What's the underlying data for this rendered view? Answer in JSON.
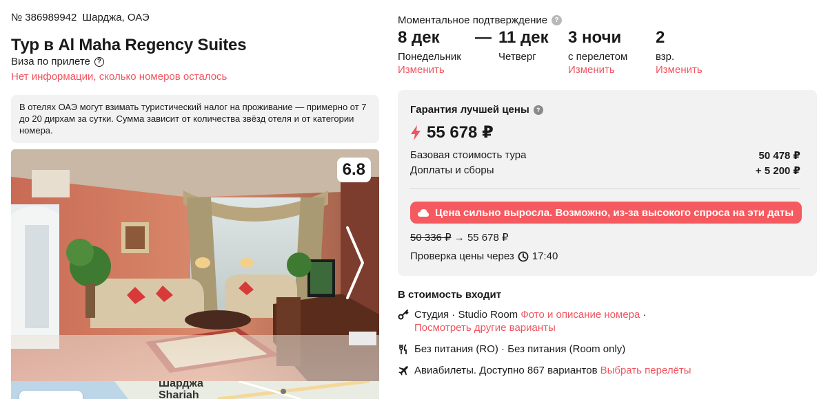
{
  "tour": {
    "id_text": "№ 386989942",
    "location": "Шарджа, ОАЭ",
    "title": "Тур в Al Maha Regency Suites",
    "visa": "Виза по прилете",
    "rooms_left": "Нет информации, сколько номеров осталось",
    "tax_note": "В отелях ОАЭ могут взимать туристический налог на проживание — примерно от 7 до 20 дирхам за сутки. Сумма зависит от количества звёзд отеля и от категории номера.",
    "rating": "6.8",
    "map_label_ru": "Шарджа",
    "map_label_en": "Shariah"
  },
  "booking": {
    "instant_confirm": "Моментальное подтверждение",
    "date_from": "8 дек",
    "date_from_day": "Понедельник",
    "dash": "—",
    "date_to": "11 дек",
    "date_to_day": "Четверг",
    "nights": "3 ночи",
    "nights_sub": "с перелетом",
    "guests": "2",
    "guests_sub": "взр.",
    "change_label": "Изменить"
  },
  "price": {
    "guarantee": "Гарантия лучшей цены",
    "total": "55 678 ₽",
    "base_label": "Базовая стоимость тура",
    "base_value": "50 478 ₽",
    "fees_label": "Доплаты и сборы",
    "fees_value": "+ 5 200 ₽",
    "alert": "Цена сильно выросла. Возможно, из-за высокого спроса на эти даты",
    "old_price": "50 336 ₽",
    "arrow": "→",
    "new_price": "55 678 ₽",
    "check_label": "Проверка цены через",
    "check_time": "17:40"
  },
  "included": {
    "title": "В стоимость входит",
    "room_text": "Студия · Studio Room",
    "room_link": "Фото и описание номера",
    "room_sep": "·",
    "other_variants": "Посмотреть другие варианты",
    "meal_text": "Без питания (RO) · Без питания (Room only)",
    "flight_text": "Авиабилеты. Доступно 867 вариантов",
    "flight_link": "Выбрать перелёты"
  },
  "colors": {
    "accent": "#f0545f",
    "alert_bg": "#f45a5f",
    "card_bg": "#f2f2f2"
  },
  "icons": {
    "visa_help": "question-circle-icon",
    "instant_help": "question-circle-icon",
    "guarantee_help": "question-circle-icon",
    "price_spike": "lightning-icon",
    "alert": "cloud-icon",
    "timer": "clock-icon",
    "room": "key-icon",
    "meal": "fork-knife-icon",
    "flight": "airplane-icon",
    "gallery_next": "chevron-right-icon"
  }
}
